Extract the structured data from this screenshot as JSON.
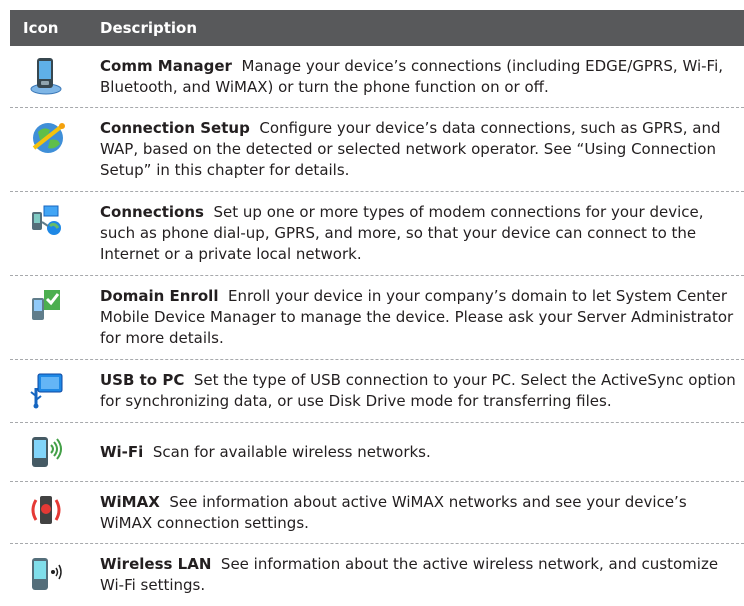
{
  "header": {
    "icon_col": "Icon",
    "desc_col": "Description"
  },
  "rows": [
    {
      "icon": "comm-manager-icon",
      "title": "Comm Manager",
      "text": "Manage your device’s connections (including EDGE/GPRS, Wi-Fi, Bluetooth, and WiMAX) or turn the phone function on or off."
    },
    {
      "icon": "connection-setup-icon",
      "title": "Connection Setup",
      "text": "Configure your device’s data connections, such as GPRS, and WAP, based on the detected or selected network operator. See “Using Connection Setup” in this chapter for details."
    },
    {
      "icon": "connections-icon",
      "title": "Connections",
      "text": "Set up one or more types of modem connections for your device, such as phone dial-up, GPRS, and more, so that your device can connect to the Internet or a private local network."
    },
    {
      "icon": "domain-enroll-icon",
      "title": "Domain Enroll",
      "text": "Enroll your device in your company’s domain to let System Center Mobile Device Manager to manage the device. Please ask your Server Administrator for more details."
    },
    {
      "icon": "usb-to-pc-icon",
      "title": "USB to PC",
      "text": "Set the type of USB connection to your PC. Select the ActiveSync option for synchronizing data, or use Disk Drive mode for transferring files."
    },
    {
      "icon": "wifi-icon",
      "title": "Wi-Fi",
      "text": "Scan for available wireless networks."
    },
    {
      "icon": "wimax-icon",
      "title": "WiMAX",
      "text": "See information about active WiMAX networks and see your device’s WiMAX connection settings."
    },
    {
      "icon": "wireless-lan-icon",
      "title": "Wireless LAN",
      "text": "See information about the active wireless network, and customize Wi-Fi settings."
    }
  ]
}
